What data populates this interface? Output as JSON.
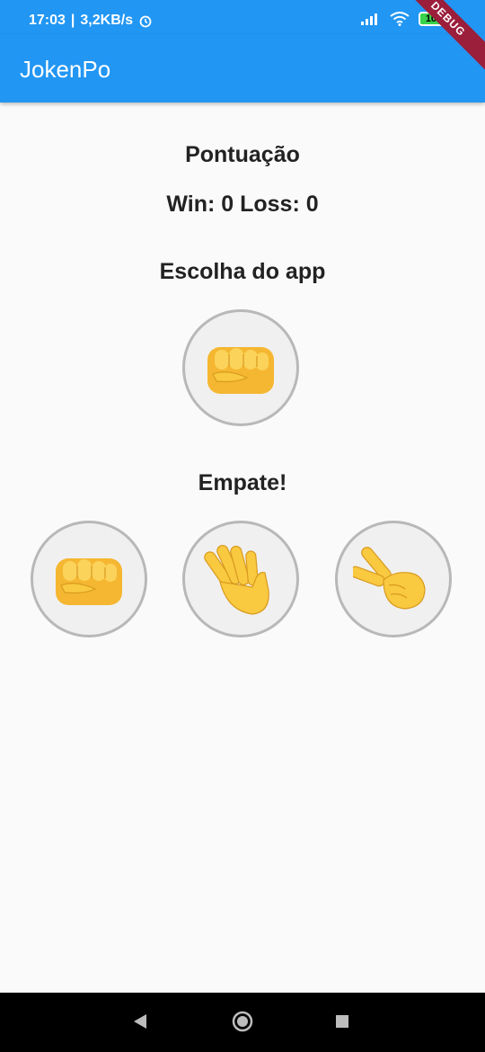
{
  "status_bar": {
    "time": "17:03",
    "network_speed": "3,2KB/s",
    "battery_level": "100"
  },
  "app_bar": {
    "title": "JokenPo",
    "debug_banner": "DEBUG"
  },
  "score": {
    "title": "Pontuação",
    "text": "Win: 0 Loss: 0"
  },
  "app_choice": {
    "title": "Escolha do app",
    "icon": "fist-icon"
  },
  "result": {
    "text": "Empate!"
  },
  "player_choices": [
    {
      "icon": "fist-icon"
    },
    {
      "icon": "hand-icon"
    },
    {
      "icon": "victory-hand-icon"
    }
  ],
  "colors": {
    "primary": "#2196f3",
    "background": "#fafafa",
    "emoji_yellow": "#f9c940",
    "debug_ribbon": "#9b1e3b"
  }
}
